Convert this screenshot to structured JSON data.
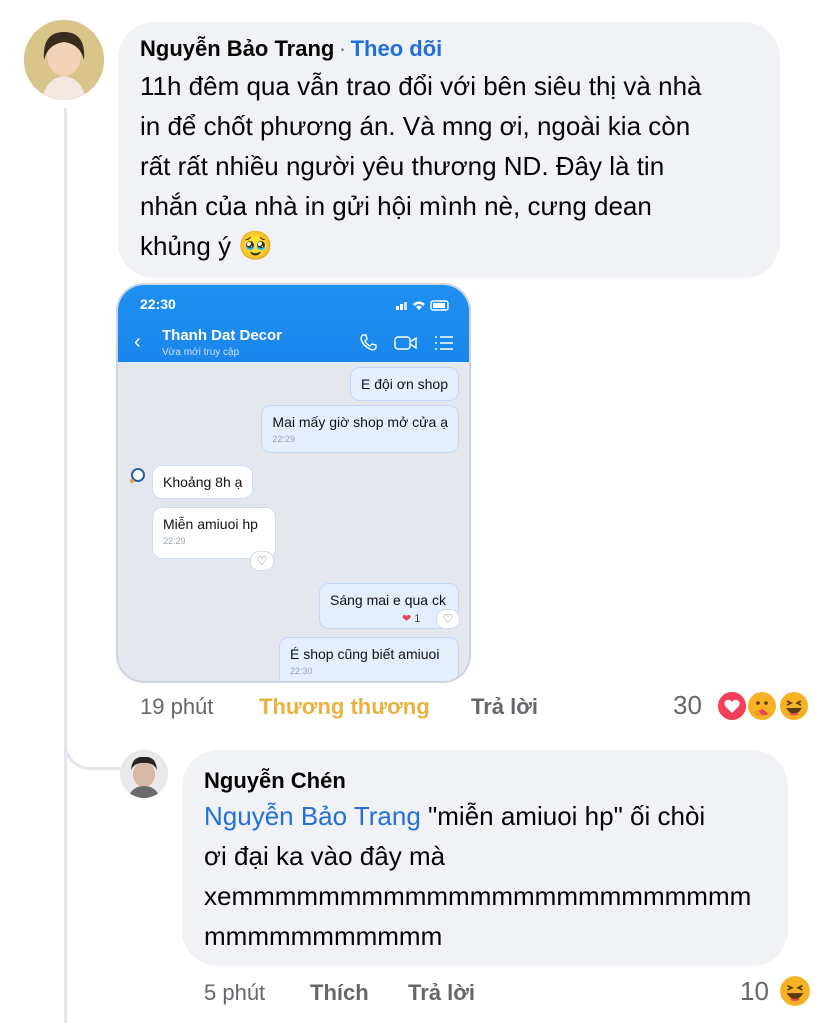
{
  "comment1": {
    "author": "Nguyễn Bảo Trang",
    "separator": "·",
    "follow_label": "Theo dõi",
    "lines": [
      "11h đêm qua vẫn trao đổi với bên siêu thị và nhà",
      "in để chốt phương án. Và mng ơi, ngoài kia còn",
      "rất rất nhiều người yêu thương ND. Đây là tin",
      "nhắn của nhà in gửi hội mình nè, cưng dean",
      "khủng ý"
    ],
    "emoji": "🥹",
    "time": "19 phút",
    "reaction_label": "Thương thương",
    "reply_label": "Trả lời",
    "reaction_count": "30",
    "reaction_icons": [
      "heart-icon",
      "care-icon",
      "haha-icon"
    ]
  },
  "phone": {
    "status_time": "22:30",
    "contact_name": "Thanh Dat Decor",
    "contact_status": "Vừa mới truy cập",
    "messages": [
      {
        "text": "E đội ơn shop",
        "time": ""
      },
      {
        "text": "Mai mấy giờ shop mở cửa ạ",
        "time": "22:29"
      },
      {
        "text": "Khoảng 8h ạ",
        "time": ""
      },
      {
        "text": "Miễn amiuoi hp",
        "time": "22:29"
      },
      {
        "text": "Sáng mai e qua ck",
        "time": "",
        "reaction_count": "1"
      },
      {
        "text": "É shop cũng biết amiuoi",
        "time": "22:30"
      }
    ]
  },
  "comment2": {
    "author": "Nguyễn Chén",
    "mention": "Nguyễn Bảo Trang",
    "line1_rest": " \"miễn amiuoi hp\" ối chòi",
    "lines": [
      "ơi đại ka vào đây mà",
      "xemmmmmmmmmmmmmmmmmmmmmmmm",
      "mmmmmmmmmmm"
    ],
    "time": "5 phút",
    "like_label": "Thích",
    "reply_label": "Trả lời",
    "reaction_count": "10",
    "reaction_icons": [
      "haha-icon"
    ]
  },
  "colors": {
    "bubble": "#f0f2f5",
    "link_blue": "#216fdb",
    "reaction_yellow": "#e7b23f",
    "meta_gray": "#65676b",
    "phone_header": "#1a86ec"
  }
}
